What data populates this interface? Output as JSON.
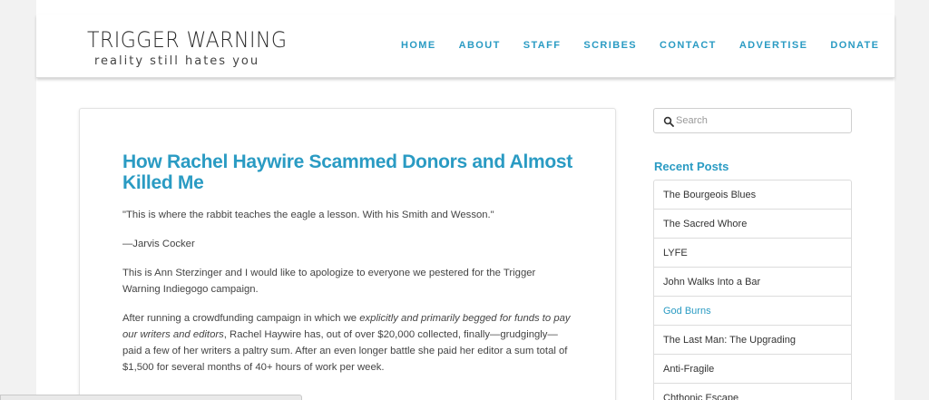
{
  "header": {
    "logo_title": "TRIGGER WARNING",
    "logo_tagline": "reality still hates you",
    "nav": [
      "HOME",
      "ABOUT",
      "STAFF",
      "SCRIBES",
      "CONTACT",
      "ADVERTISE",
      "DONATE"
    ]
  },
  "post": {
    "title": "How Rachel Haywire Scammed Donors and Almost Killed Me",
    "quote": "\"This is where the rabbit teaches the eagle a lesson. With his Smith and Wesson.\"",
    "attribution": "—Jarvis Cocker",
    "para1": "This is Ann Sterzinger and I would like to apologize to everyone we pestered for the Trigger Warning Indiegogo campaign.",
    "para2_a": "After running a crowdfunding campaign in which we ",
    "para2_em": "explicitly and primarily begged for funds to pay our writers and editors",
    "para2_b": ", Rachel Haywire has, out of over $20,000 collected, finally—grudgingly—paid a few of her writers a paltry sum. After an even longer battle she paid her editor a sum total of $1,500 for several months of 40+ hours of work per week."
  },
  "sidebar": {
    "search_placeholder": "Search",
    "recent_heading": "Recent Posts",
    "recent_posts": [
      "The Bourgeois Blues",
      "The Sacred Whore",
      "LYFE",
      "John Walks Into a Bar",
      "God Burns",
      "The Last Man: The Upgrading",
      "Anti-Fragile",
      "Chthonic Escape"
    ]
  },
  "colors": {
    "accent": "#2a9bc3",
    "text": "#444444",
    "background": "#f2f2f2"
  }
}
